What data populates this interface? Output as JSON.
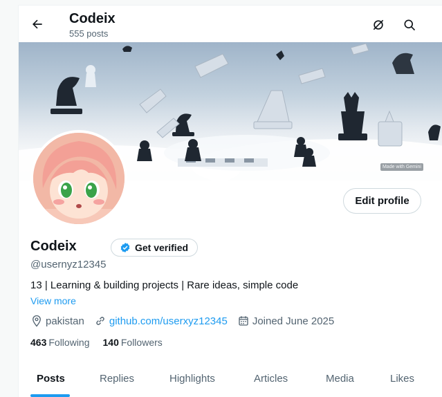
{
  "header": {
    "title": "Codeix",
    "post_count": "555 posts"
  },
  "banner": {
    "watermark": "Made with Gemini"
  },
  "profile": {
    "name": "Codeix",
    "verify_label": "Get verified",
    "handle": "@usernyz12345",
    "bio": "13 | Learning & building projects | Rare ideas, simple code",
    "view_more": "View more",
    "location": "pakistan",
    "website": "github.com/userxyz12345",
    "joined": "Joined June 2025",
    "edit_label": "Edit profile"
  },
  "stats": {
    "following_count": "463",
    "following_label": "Following",
    "followers_count": "140",
    "followers_label": "Followers"
  },
  "tabs": [
    {
      "label": "Posts",
      "active": true
    },
    {
      "label": "Replies"
    },
    {
      "label": "Highlights"
    },
    {
      "label": "Articles"
    },
    {
      "label": "Media"
    },
    {
      "label": "Likes"
    }
  ],
  "icons": [
    "back-arrow-icon",
    "grok-icon",
    "search-icon",
    "location-icon",
    "link-icon",
    "calendar-icon",
    "verified-badge-icon"
  ],
  "colors": {
    "accent": "#1d9bf0",
    "text": "#0f1419",
    "muted": "#536471"
  }
}
